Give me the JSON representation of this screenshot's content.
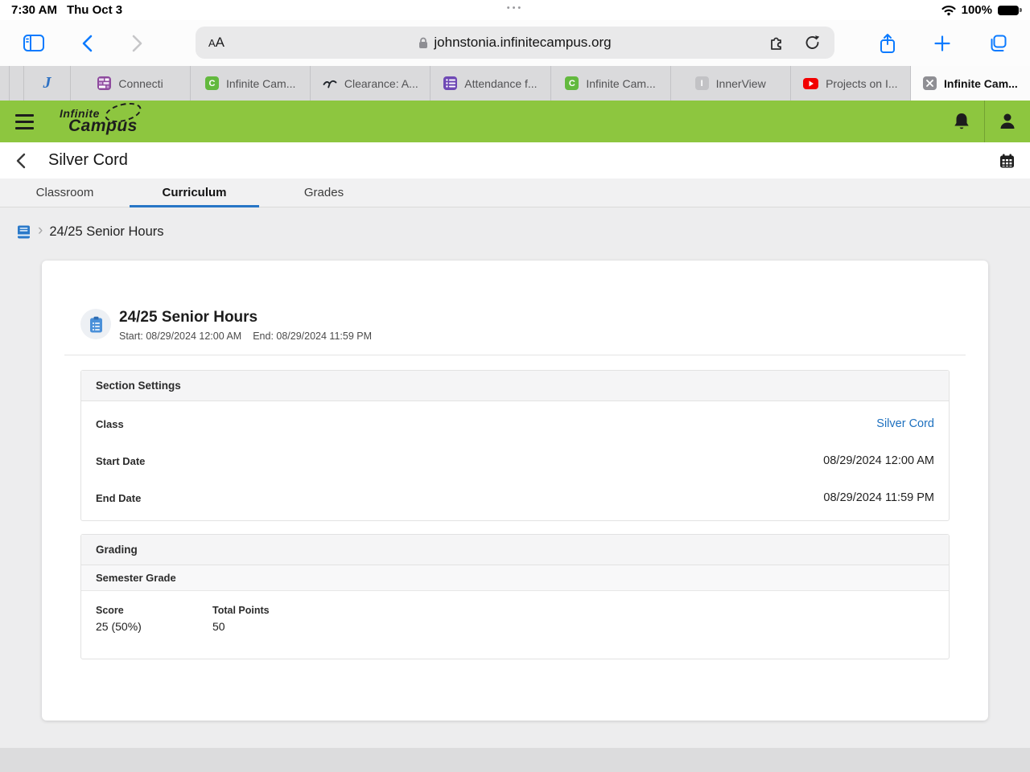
{
  "status_bar": {
    "time": "7:30 AM",
    "date": "Thu Oct 3",
    "dots": "•••",
    "battery_pct": "100%"
  },
  "browser": {
    "reader_label_small": "A",
    "reader_label_big": "A",
    "url": "johnstonia.infinitecampus.org",
    "pinned_tab": {
      "icon_letter": "J"
    },
    "tabs": [
      {
        "label": "Connecti"
      },
      {
        "label": "Infinite Cam...",
        "icon_letter": "C"
      },
      {
        "label": "Clearance: A..."
      },
      {
        "label": "Attendance f..."
      },
      {
        "label": "Infinite Cam...",
        "icon_letter": "C"
      },
      {
        "label": "InnerView",
        "icon_letter": "I"
      },
      {
        "label": "Projects on I..."
      },
      {
        "label": "Infinite Cam..."
      }
    ]
  },
  "app": {
    "brand": {
      "line1": "Infinite",
      "line2": "Campus"
    },
    "page_title": "Silver Cord",
    "nav_tabs": [
      {
        "label": "Classroom"
      },
      {
        "label": "Curriculum"
      },
      {
        "label": "Grades"
      }
    ],
    "breadcrumb": {
      "separator": "›",
      "current": "24/25 Senior Hours"
    },
    "assignment": {
      "title": "24/25 Senior Hours",
      "start": "Start: 08/29/2024 12:00 AM",
      "end": "End: 08/29/2024 11:59 PM"
    },
    "section_settings": {
      "title": "Section Settings",
      "rows": [
        {
          "label": "Class",
          "value": "Silver Cord"
        },
        {
          "label": "Start Date",
          "value": "08/29/2024 12:00 AM"
        },
        {
          "label": "End Date",
          "value": "08/29/2024 11:59 PM"
        }
      ]
    },
    "grading": {
      "title": "Grading",
      "subtitle": "Semester Grade",
      "score_label": "Score",
      "score_value": "25 (50%)",
      "total_label": "Total Points",
      "total_value": "50"
    }
  },
  "colors": {
    "brand_green": "#8dc63f",
    "ios_blue": "#0a7aff",
    "link_blue": "#1d70bf",
    "tab_underline_blue": "#2776c6"
  }
}
